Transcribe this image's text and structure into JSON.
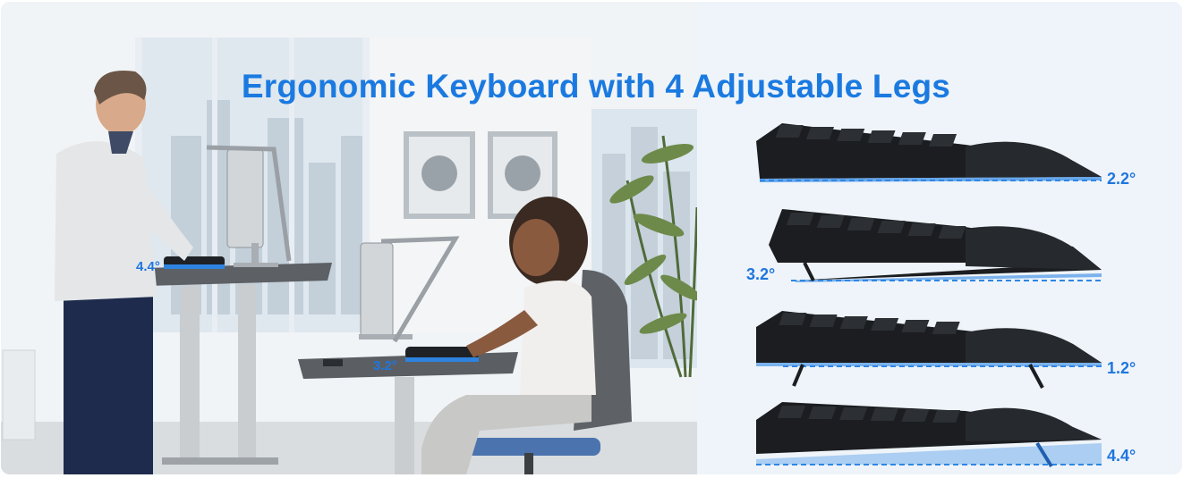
{
  "banner": {
    "title": "Ergonomic Keyboard with 4 Adjustable Legs",
    "title_color": "#1b7ae0",
    "accent_blue": "#1f76de"
  },
  "scene": {
    "standing_desk_angle": "4.4°",
    "sitting_desk_angle": "3.2°"
  },
  "keyboard_angles": [
    {
      "label": "2.2°"
    },
    {
      "label": "3.2°"
    },
    {
      "label": "1.2°"
    },
    {
      "label": "4.4°"
    }
  ]
}
